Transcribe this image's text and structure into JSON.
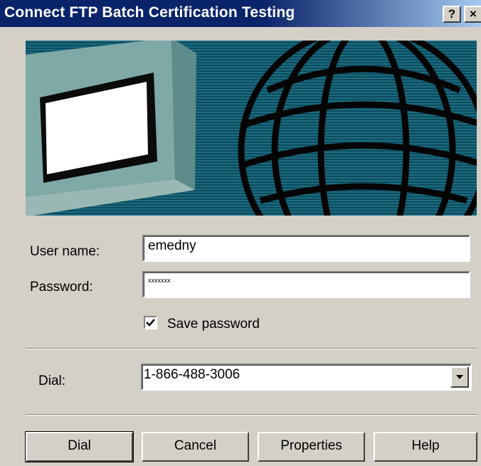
{
  "window": {
    "title": "Connect FTP Batch Certification Testing",
    "help_glyph": "?",
    "close_glyph": "×"
  },
  "form": {
    "username_label": "User name:",
    "username_value": "emedny",
    "password_label": "Password:",
    "password_value": "xxxxxxx",
    "save_password_label": "Save password",
    "save_password_checked": true,
    "dial_label": "Dial:",
    "dial_value": "1-866-488-3006"
  },
  "buttons": {
    "dial": "Dial",
    "cancel": "Cancel",
    "properties": "Properties",
    "help": "Help"
  },
  "icons": {
    "banner": "computer-globe-banner",
    "dropdown": "chevron-down-icon",
    "check": "check-icon"
  }
}
